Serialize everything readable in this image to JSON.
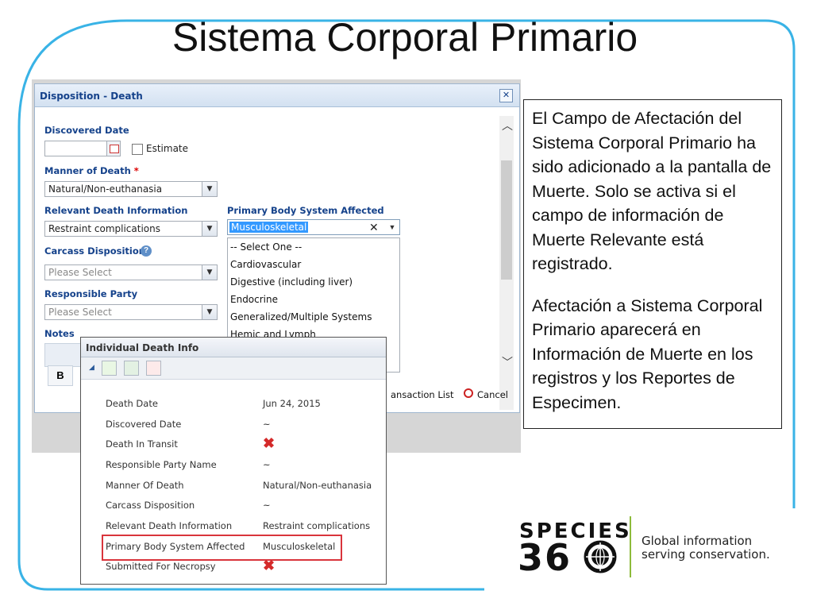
{
  "slide_title": "Sistema Corporal Primario",
  "dialog": {
    "title": "Disposition - Death",
    "close_glyph": "✕",
    "discovered_date_label": "Discovered Date",
    "estimate_label": "Estimate",
    "manner_label": "Manner of Death",
    "required_mark": "*",
    "manner_value": "Natural/Non-euthanasia",
    "relevant_label": "Relevant Death Information",
    "relevant_value": "Restraint complications",
    "pbsa_label": "Primary Body System Affected",
    "pbsa_value": "Musculoskeletal",
    "carcass_label": "Carcass Disposition",
    "carcass_placeholder": "Please Select",
    "responsible_label": "Responsible Party",
    "responsible_placeholder": "Please Select",
    "notes_label": "Notes",
    "bold_label": "B",
    "transaction_list": "ansaction List",
    "cancel_label": "Cancel",
    "dropdown_options": [
      "-- Select One --",
      "Cardiovascular",
      "Digestive (including liver)",
      "Endocrine",
      "Generalized/Multiple Systems",
      "Hemic and Lymph"
    ]
  },
  "individual_death_info": {
    "title": "Individual Death Info",
    "rows": [
      {
        "label": "Death Date",
        "value": "Jun 24, 2015"
      },
      {
        "label": "Discovered Date",
        "value": "~"
      },
      {
        "label": "Death In Transit",
        "value": ""
      },
      {
        "label": "Responsible Party Name",
        "value": "~"
      },
      {
        "label": "Manner Of Death",
        "value": "Natural/Non-euthanasia"
      },
      {
        "label": "Carcass Disposition",
        "value": "~"
      },
      {
        "label": "Relevant Death Information",
        "value": "Restraint complications"
      },
      {
        "label": "Primary Body System Affected",
        "value": "Musculoskeletal"
      },
      {
        "label": "Submitted For Necropsy",
        "value": ""
      }
    ],
    "x_icon": "red-x-icon"
  },
  "callout": {
    "paragraph1": "El Campo de Afectación del Sistema Corporal Primario ha sido adicionado a la pantalla de Muerte. Solo se activa si el campo de información de Muerte Relevante está registrado.",
    "paragraph2": "Afectación a Sistema Corporal Primario aparecerá en Información de Muerte en los registros y los Reportes de Especimen."
  },
  "logo": {
    "line1": "SPECIES",
    "line2": "36",
    "tagline1": "Global information",
    "tagline2": "serving conservation."
  },
  "colors": {
    "accent_frame": "#39b3e6",
    "highlight": "#d9343c",
    "header_text": "#15428b",
    "logo_green": "#8dbb3a"
  }
}
